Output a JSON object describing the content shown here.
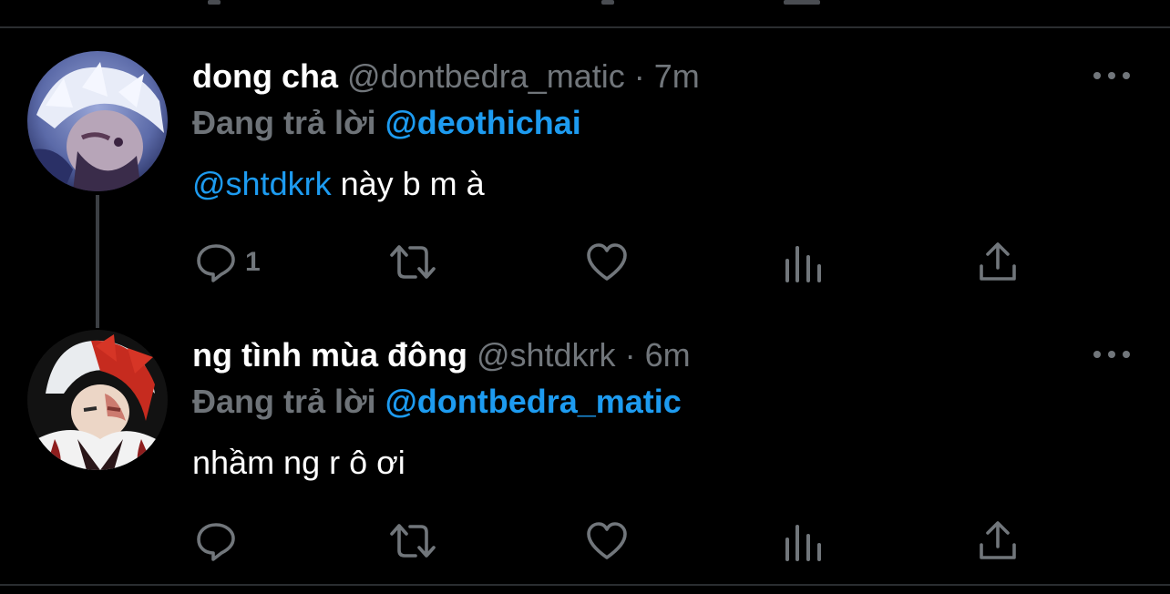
{
  "tweets": [
    {
      "display_name": "dong cha",
      "handle": "@dontbedra_matic",
      "separator": "·",
      "time": "7m",
      "reply_prefix": "Đang trả lời",
      "reply_to": "@deothichai",
      "mention": "@shtdkrk",
      "text": " này b m à",
      "reply_count": "1"
    },
    {
      "display_name": "ng tình mùa đông",
      "handle": "@shtdkrk",
      "separator": "·",
      "time": "6m",
      "reply_prefix": "Đang trả lời",
      "reply_to": "@dontbedra_matic",
      "text": "nhầm ng r ô ơi",
      "reply_count": ""
    }
  ],
  "icons": [
    "more-icon",
    "reply-icon",
    "retweet-icon",
    "like-icon",
    "views-icon",
    "share-icon"
  ],
  "colors": {
    "background": "#000000",
    "text": "#ffffff",
    "secondary": "#71767b",
    "link": "#1d9bf0",
    "divider": "#2a2d30"
  }
}
